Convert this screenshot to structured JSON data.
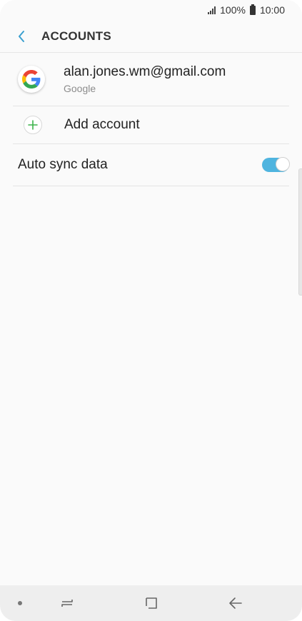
{
  "status_bar": {
    "battery_percent": "100%",
    "time": "10:00",
    "icons": [
      "signal-icon",
      "battery-icon"
    ]
  },
  "header": {
    "title": "ACCOUNTS",
    "back_icon": "chevron-left-icon"
  },
  "accounts": [
    {
      "email": "alan.jones.wm@gmail.com",
      "provider": "Google",
      "icon": "google-logo-icon"
    }
  ],
  "add_account": {
    "label": "Add account",
    "icon": "plus-icon"
  },
  "auto_sync": {
    "label": "Auto sync data",
    "enabled": true
  },
  "nav_bar": {
    "icons": [
      "recent-apps-icon",
      "home-icon",
      "back-arrow-icon"
    ]
  },
  "colors": {
    "accent": "#4fb4df",
    "plus_green": "#3cb44a",
    "background": "#fafafa",
    "nav_background": "#eeeeee"
  }
}
